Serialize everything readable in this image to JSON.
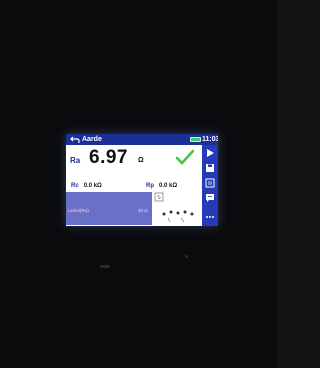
{
  "device_screen": {
    "title": "Aarde",
    "clock": "11:03",
    "main_result": {
      "label": "Ra",
      "value": "6.97",
      "unit": "Ω"
    },
    "sub_results": [
      {
        "label": "Rc",
        "value": "0.0",
        "unit": "kΩ"
      },
      {
        "label": "Rp",
        "value": "0.0",
        "unit": "kΩ"
      }
    ],
    "limit": {
      "label": "Limiet(Ra)",
      "value": "20 Ω"
    },
    "status_icon": "check-icon",
    "sidebar": [
      "play-icon",
      "save-icon",
      "list-icon",
      "comment-icon",
      "more-icon"
    ],
    "colors": {
      "titlebar": "#1c2f96",
      "sidebar": "#2639b8",
      "check": "#49c34a",
      "limit_panel": "#6a6fc7"
    }
  }
}
